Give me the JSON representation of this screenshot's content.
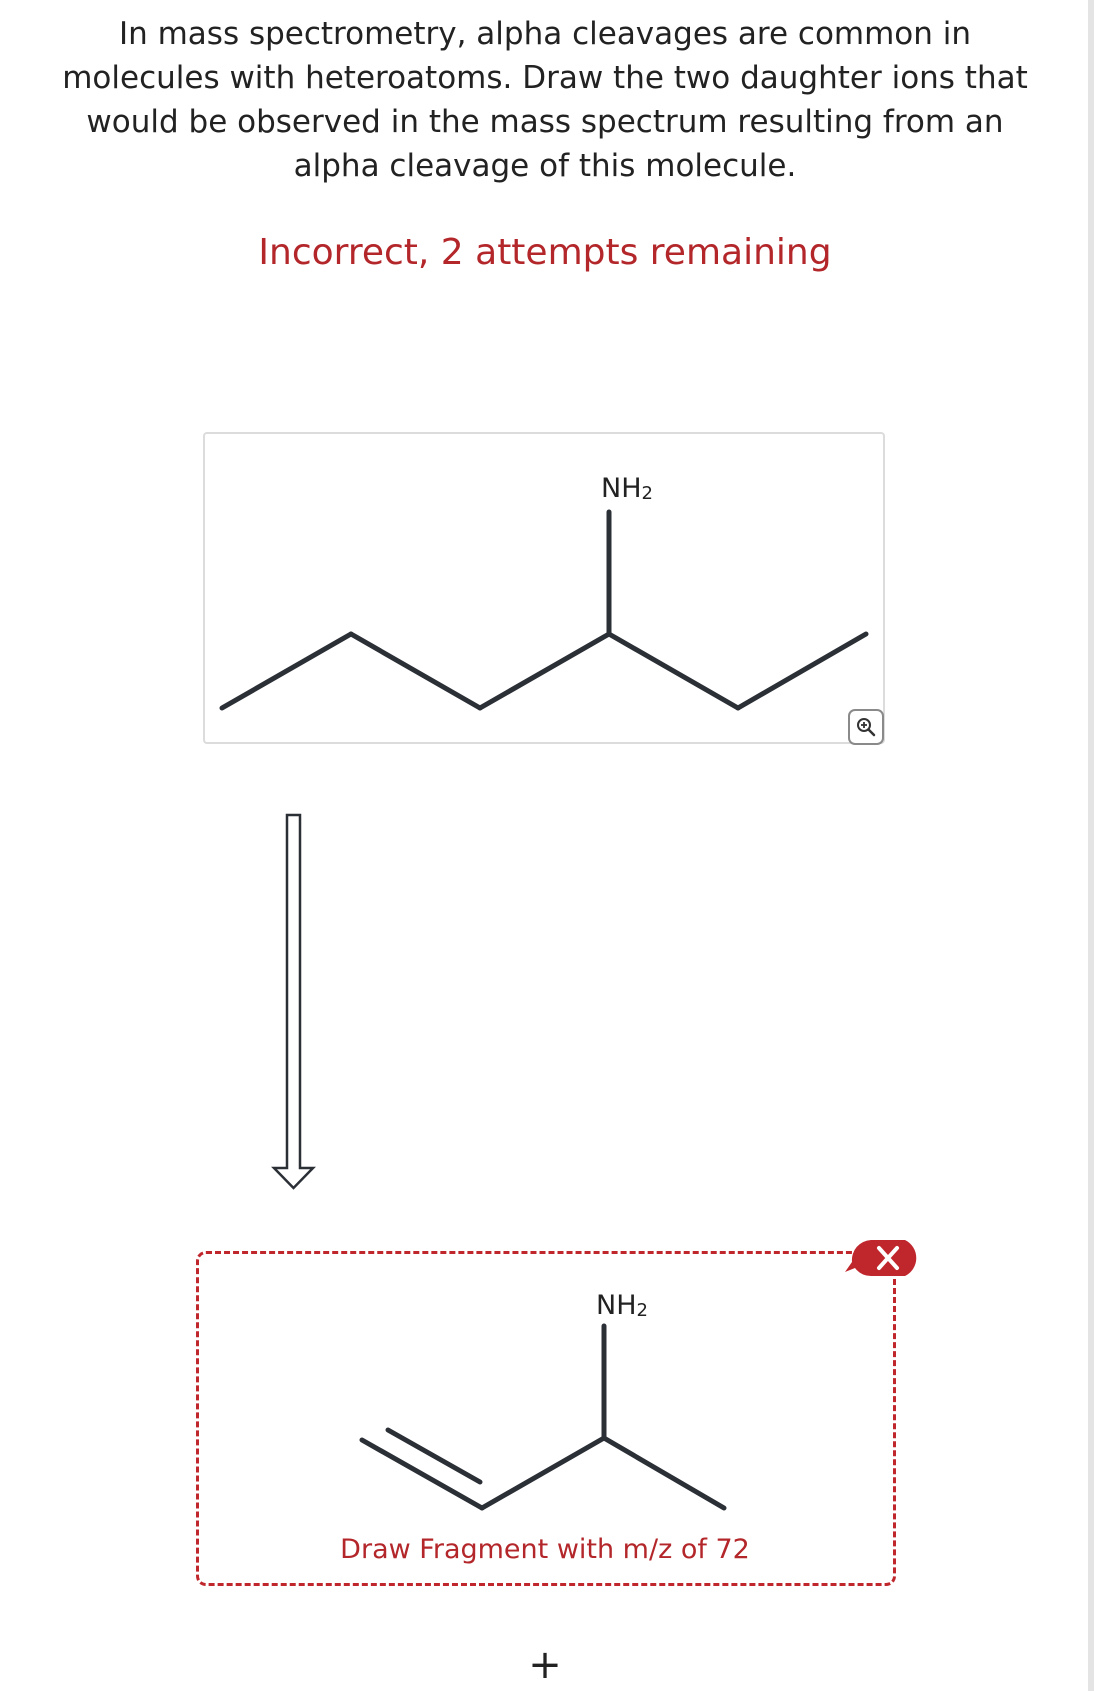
{
  "question": {
    "text": "In mass spectrometry, alpha cleavages are common in molecules with heteroatoms. Draw the two daughter ions that would be observed in the mass spectrum resulting from an alpha cleavage of this molecule."
  },
  "status": {
    "text": "Incorrect, 2 attempts remaining",
    "color": "#b3262a"
  },
  "given_molecule": {
    "substituent_label": "NH2",
    "zoom_icon": "zoom-in-icon"
  },
  "reaction_arrow": {
    "icon": "hollow-down-arrow-icon"
  },
  "answer": {
    "substituent_label": "NH2",
    "prompt": "Draw Fragment with m/z of 72",
    "feedback_icon": "incorrect-x-icon",
    "accent_color": "#c0272d"
  },
  "add_button": {
    "label": "+"
  }
}
